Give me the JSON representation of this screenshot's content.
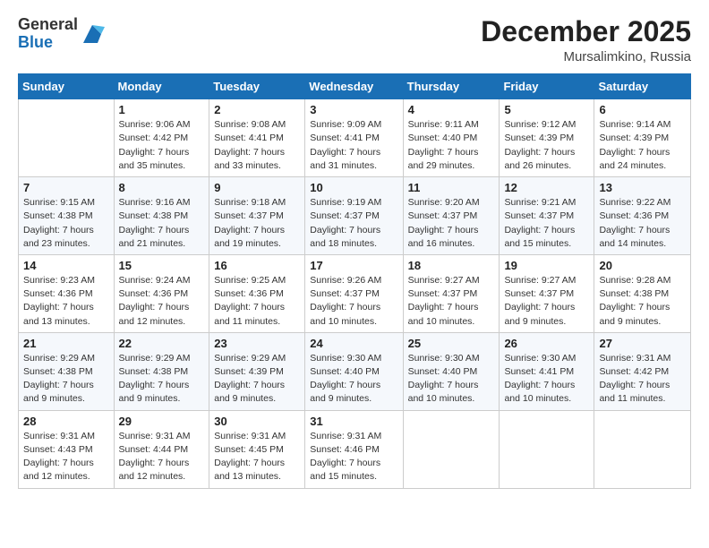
{
  "header": {
    "logo_general": "General",
    "logo_blue": "Blue",
    "month_title": "December 2025",
    "location": "Mursalimkino, Russia"
  },
  "days_of_week": [
    "Sunday",
    "Monday",
    "Tuesday",
    "Wednesday",
    "Thursday",
    "Friday",
    "Saturday"
  ],
  "weeks": [
    [
      {
        "day": "",
        "info": ""
      },
      {
        "day": "1",
        "info": "Sunrise: 9:06 AM\nSunset: 4:42 PM\nDaylight: 7 hours\nand 35 minutes."
      },
      {
        "day": "2",
        "info": "Sunrise: 9:08 AM\nSunset: 4:41 PM\nDaylight: 7 hours\nand 33 minutes."
      },
      {
        "day": "3",
        "info": "Sunrise: 9:09 AM\nSunset: 4:41 PM\nDaylight: 7 hours\nand 31 minutes."
      },
      {
        "day": "4",
        "info": "Sunrise: 9:11 AM\nSunset: 4:40 PM\nDaylight: 7 hours\nand 29 minutes."
      },
      {
        "day": "5",
        "info": "Sunrise: 9:12 AM\nSunset: 4:39 PM\nDaylight: 7 hours\nand 26 minutes."
      },
      {
        "day": "6",
        "info": "Sunrise: 9:14 AM\nSunset: 4:39 PM\nDaylight: 7 hours\nand 24 minutes."
      }
    ],
    [
      {
        "day": "7",
        "info": "Sunrise: 9:15 AM\nSunset: 4:38 PM\nDaylight: 7 hours\nand 23 minutes."
      },
      {
        "day": "8",
        "info": "Sunrise: 9:16 AM\nSunset: 4:38 PM\nDaylight: 7 hours\nand 21 minutes."
      },
      {
        "day": "9",
        "info": "Sunrise: 9:18 AM\nSunset: 4:37 PM\nDaylight: 7 hours\nand 19 minutes."
      },
      {
        "day": "10",
        "info": "Sunrise: 9:19 AM\nSunset: 4:37 PM\nDaylight: 7 hours\nand 18 minutes."
      },
      {
        "day": "11",
        "info": "Sunrise: 9:20 AM\nSunset: 4:37 PM\nDaylight: 7 hours\nand 16 minutes."
      },
      {
        "day": "12",
        "info": "Sunrise: 9:21 AM\nSunset: 4:37 PM\nDaylight: 7 hours\nand 15 minutes."
      },
      {
        "day": "13",
        "info": "Sunrise: 9:22 AM\nSunset: 4:36 PM\nDaylight: 7 hours\nand 14 minutes."
      }
    ],
    [
      {
        "day": "14",
        "info": "Sunrise: 9:23 AM\nSunset: 4:36 PM\nDaylight: 7 hours\nand 13 minutes."
      },
      {
        "day": "15",
        "info": "Sunrise: 9:24 AM\nSunset: 4:36 PM\nDaylight: 7 hours\nand 12 minutes."
      },
      {
        "day": "16",
        "info": "Sunrise: 9:25 AM\nSunset: 4:36 PM\nDaylight: 7 hours\nand 11 minutes."
      },
      {
        "day": "17",
        "info": "Sunrise: 9:26 AM\nSunset: 4:37 PM\nDaylight: 7 hours\nand 10 minutes."
      },
      {
        "day": "18",
        "info": "Sunrise: 9:27 AM\nSunset: 4:37 PM\nDaylight: 7 hours\nand 10 minutes."
      },
      {
        "day": "19",
        "info": "Sunrise: 9:27 AM\nSunset: 4:37 PM\nDaylight: 7 hours\nand 9 minutes."
      },
      {
        "day": "20",
        "info": "Sunrise: 9:28 AM\nSunset: 4:38 PM\nDaylight: 7 hours\nand 9 minutes."
      }
    ],
    [
      {
        "day": "21",
        "info": "Sunrise: 9:29 AM\nSunset: 4:38 PM\nDaylight: 7 hours\nand 9 minutes."
      },
      {
        "day": "22",
        "info": "Sunrise: 9:29 AM\nSunset: 4:38 PM\nDaylight: 7 hours\nand 9 minutes."
      },
      {
        "day": "23",
        "info": "Sunrise: 9:29 AM\nSunset: 4:39 PM\nDaylight: 7 hours\nand 9 minutes."
      },
      {
        "day": "24",
        "info": "Sunrise: 9:30 AM\nSunset: 4:40 PM\nDaylight: 7 hours\nand 9 minutes."
      },
      {
        "day": "25",
        "info": "Sunrise: 9:30 AM\nSunset: 4:40 PM\nDaylight: 7 hours\nand 10 minutes."
      },
      {
        "day": "26",
        "info": "Sunrise: 9:30 AM\nSunset: 4:41 PM\nDaylight: 7 hours\nand 10 minutes."
      },
      {
        "day": "27",
        "info": "Sunrise: 9:31 AM\nSunset: 4:42 PM\nDaylight: 7 hours\nand 11 minutes."
      }
    ],
    [
      {
        "day": "28",
        "info": "Sunrise: 9:31 AM\nSunset: 4:43 PM\nDaylight: 7 hours\nand 12 minutes."
      },
      {
        "day": "29",
        "info": "Sunrise: 9:31 AM\nSunset: 4:44 PM\nDaylight: 7 hours\nand 12 minutes."
      },
      {
        "day": "30",
        "info": "Sunrise: 9:31 AM\nSunset: 4:45 PM\nDaylight: 7 hours\nand 13 minutes."
      },
      {
        "day": "31",
        "info": "Sunrise: 9:31 AM\nSunset: 4:46 PM\nDaylight: 7 hours\nand 15 minutes."
      },
      {
        "day": "",
        "info": ""
      },
      {
        "day": "",
        "info": ""
      },
      {
        "day": "",
        "info": ""
      }
    ]
  ]
}
